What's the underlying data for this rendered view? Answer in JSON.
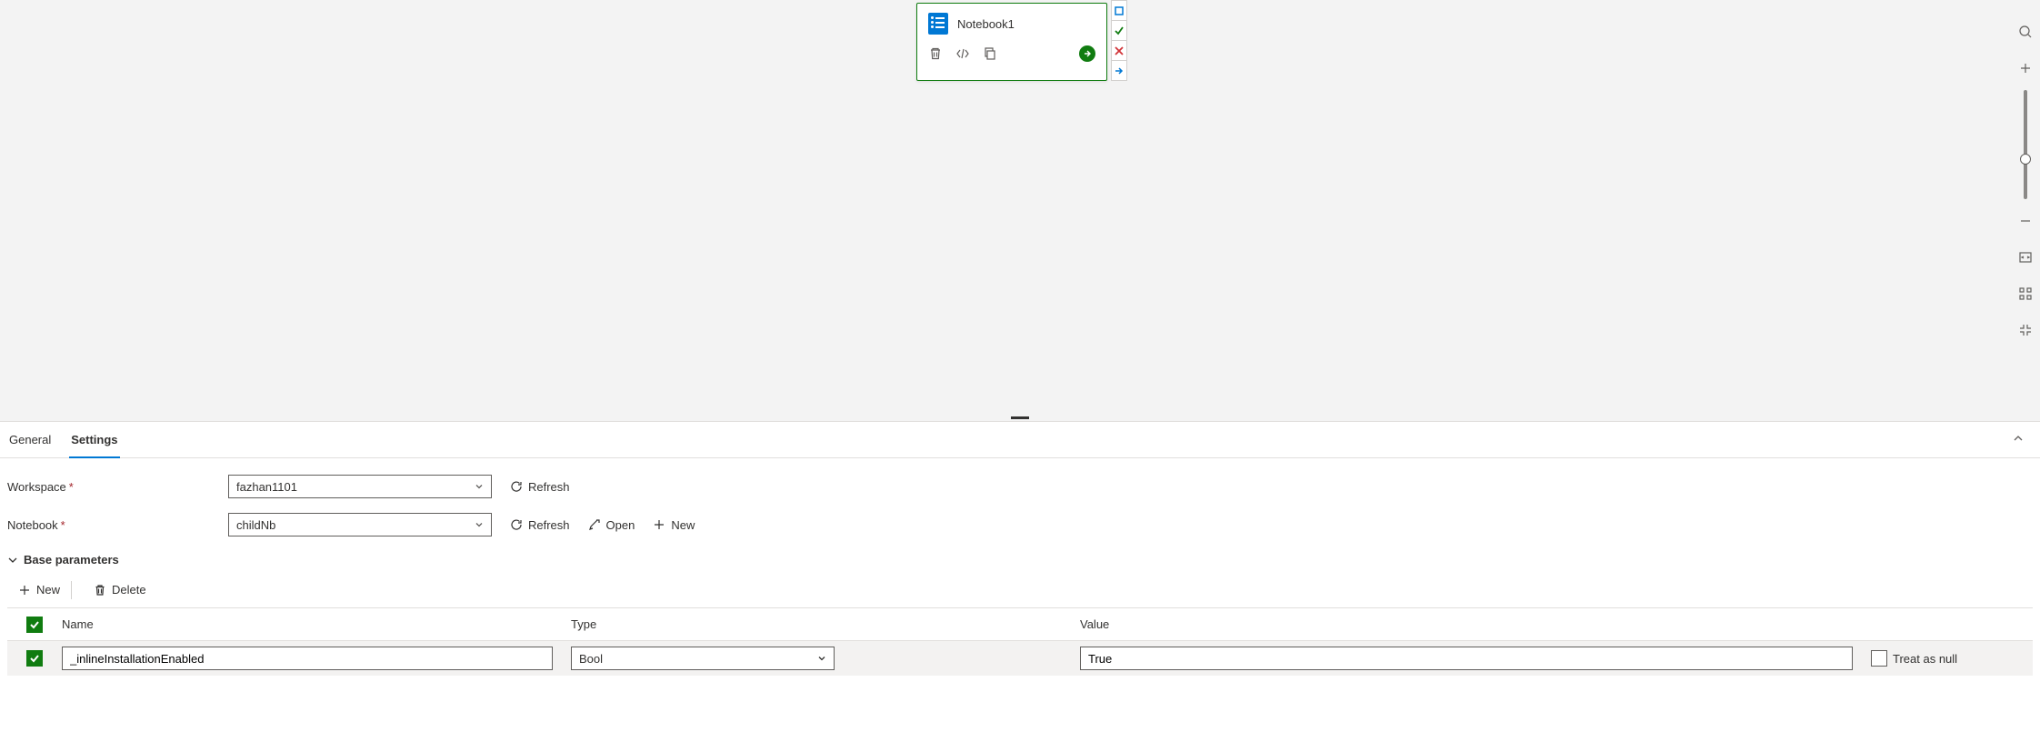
{
  "node": {
    "title": "Notebook1",
    "status_markers": [
      "pending",
      "success",
      "error",
      "next"
    ]
  },
  "tabs": {
    "general": "General",
    "settings": "Settings",
    "active": "settings"
  },
  "form": {
    "workspace_label": "Workspace",
    "workspace_value": "fazhan1101",
    "notebook_label": "Notebook",
    "notebook_value": "childNb",
    "refresh_label": "Refresh",
    "open_label": "Open",
    "new_label": "New"
  },
  "section": {
    "title": "Base parameters"
  },
  "param_toolbar": {
    "new_label": "New",
    "delete_label": "Delete"
  },
  "param_table": {
    "headers": {
      "name": "Name",
      "type": "Type",
      "value": "Value",
      "null": "Treat as null"
    },
    "row": {
      "checked": true,
      "name": "_inlineInstallationEnabled",
      "type": "Bool",
      "value": "True",
      "treat_as_null": false
    }
  }
}
